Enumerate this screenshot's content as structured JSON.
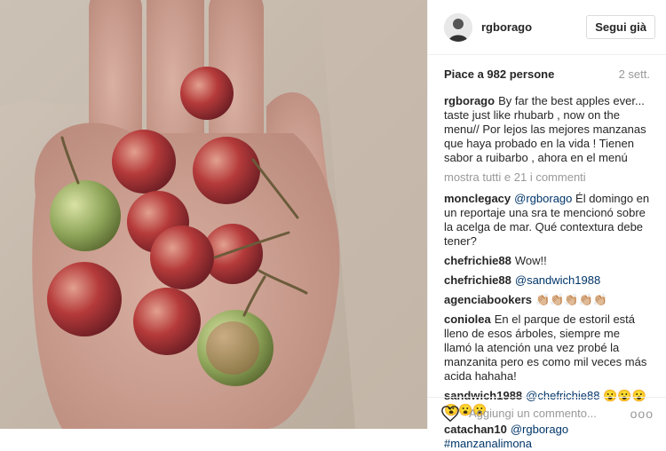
{
  "post": {
    "username": "rgborago",
    "follow_label": "Segui già",
    "likes_text": "Piace a 982 persone",
    "time_ago": "2 sett.",
    "caption": "By far the best apples ever... taste just like rhubarb , now on the menu// Por lejos las mejores manzanas que haya probado en la vida ! Tienen sabor a ruibarbo , ahora en el menú",
    "show_all": "mostra tutti e 21 i commenti"
  },
  "comments": [
    {
      "user": "monclegacy",
      "mention": "@rgborago",
      "text": "Él domingo en un reportaje una sra te mencionó sobre la acelga de mar. Qué contextura debe tener?"
    },
    {
      "user": "chefrichie88",
      "text": "Wow!!"
    },
    {
      "user": "chefrichie88",
      "mention": "@sandwich1988"
    },
    {
      "user": "agenciabookers",
      "text": "👏🏼👏🏼👏🏼👏🏼👏🏼"
    },
    {
      "user": "coniolea",
      "text": "En el parque de estoril está lleno de esos árboles, siempre me llamó la atención una vez probé la manzanita pero es como mil veces más acida hahaha!"
    },
    {
      "user": "sandwich1988",
      "mention": "@chefrichie88",
      "text": "😮😮😮😮😮😮"
    },
    {
      "user": "catachan10",
      "mention": "@rgborago",
      "text2": "#manzanalimona"
    }
  ],
  "footer": {
    "add_comment_placeholder": "Aggiungi un commento...",
    "options": "ooo"
  },
  "colors": {
    "link": "#003569",
    "muted": "#999999",
    "border": "#efefef"
  }
}
